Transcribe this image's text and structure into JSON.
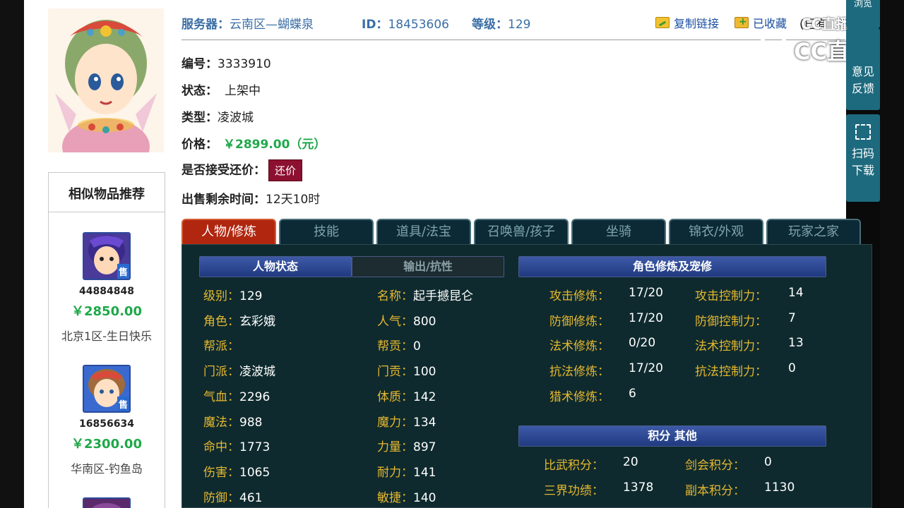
{
  "meta": {
    "server_label": "服务器：",
    "server_value": "云南区—蝴蝶泉",
    "id_label": "ID：",
    "id_value": "18453606",
    "level_label": "等级：",
    "level_value": "129"
  },
  "toolbar": {
    "copy_link": "复制链接",
    "favorited": "已收藏",
    "cut_text": "(已有"
  },
  "fields": {
    "serial_label": "编号：",
    "serial_value": "3333910",
    "status_label": "状态：",
    "status_value": "上架中",
    "type_label": "类型：",
    "type_value": "凌波城",
    "price_label": "价格：",
    "price_value": "￥2899.00（元）",
    "bargain_label": "是否接受还价：",
    "bargain_button": "还价",
    "remaining_label": "出售剩余时间：",
    "remaining_value": "12天10时"
  },
  "watermark": {
    "brand": "CC直播",
    "mini": "CC直播"
  },
  "float_panel": {
    "top_cut": "浏览",
    "feedback_line1": "意见",
    "feedback_line2": "反馈",
    "scan_line1": "扫码",
    "scan_line2": "下载"
  },
  "recommend": {
    "title": "相似物品推荐",
    "items": [
      {
        "id": "44884848",
        "price": "￥2850.00",
        "server": "北京1区-生日快乐",
        "badge": "售"
      },
      {
        "id": "16856634",
        "price": "￥2300.00",
        "server": "华南区-钓鱼岛",
        "badge": "售"
      }
    ]
  },
  "tabs": [
    {
      "label": "人物/修炼",
      "active": true
    },
    {
      "label": "技能",
      "active": false
    },
    {
      "label": "道具/法宝",
      "active": false
    },
    {
      "label": "召唤兽/孩子",
      "active": false
    },
    {
      "label": "坐骑",
      "active": false
    },
    {
      "label": "锦衣/外观",
      "active": false
    },
    {
      "label": "玩家之家",
      "active": false
    }
  ],
  "panel": {
    "char_status_head": "人物状态",
    "output_head": "输出/抗性",
    "cultivation_head": "角色修炼及宠修",
    "score_head": "积分  其他",
    "left_stats": [
      {
        "k": "级别：",
        "v": "129"
      },
      {
        "k": "角色：",
        "v": "玄彩娥"
      },
      {
        "k": "帮派：",
        "v": ""
      },
      {
        "k": "门派：",
        "v": "凌波城"
      },
      {
        "k": "气血：",
        "v": "2296"
      },
      {
        "k": "魔法：",
        "v": "988"
      },
      {
        "k": "命中：",
        "v": "1773"
      },
      {
        "k": "伤害：",
        "v": "1065"
      },
      {
        "k": "防御：",
        "v": "461"
      }
    ],
    "mid_stats": [
      {
        "k": "名称：",
        "v": "起手撼昆仑"
      },
      {
        "k": "人气：",
        "v": "800"
      },
      {
        "k": "帮贡：",
        "v": "0"
      },
      {
        "k": "门贡：",
        "v": "100"
      },
      {
        "k": "体质：",
        "v": "142"
      },
      {
        "k": "魔力：",
        "v": "134"
      },
      {
        "k": "力量：",
        "v": "897"
      },
      {
        "k": "耐力：",
        "v": "141"
      },
      {
        "k": "敏捷：",
        "v": "140"
      }
    ],
    "cult_stats": [
      {
        "k": "攻击修炼：",
        "v": "17/20"
      },
      {
        "k": "防御修炼：",
        "v": "17/20"
      },
      {
        "k": "法术修炼：",
        "v": "0/20"
      },
      {
        "k": "抗法修炼：",
        "v": "17/20"
      },
      {
        "k": "猎术修炼：",
        "v": "6"
      }
    ],
    "ctrl_stats": [
      {
        "k": "攻击控制力：",
        "v": "14"
      },
      {
        "k": "防御控制力：",
        "v": "7"
      },
      {
        "k": "法术控制力：",
        "v": "13"
      },
      {
        "k": "抗法控制力：",
        "v": "0"
      }
    ],
    "score_stats": [
      {
        "k": "比武积分：",
        "v": "20"
      },
      {
        "k": "剑会积分：",
        "v": "0"
      },
      {
        "k": "三界功绩：",
        "v": "1378"
      },
      {
        "k": "副本积分：",
        "v": "1130"
      }
    ]
  },
  "colors": {
    "accent_blue": "#3a6ea5",
    "price_green": "#1fa84a",
    "tab_active": "#b0260f",
    "panel_bg": "#0e2a2e",
    "stat_key": "#e6b830"
  }
}
